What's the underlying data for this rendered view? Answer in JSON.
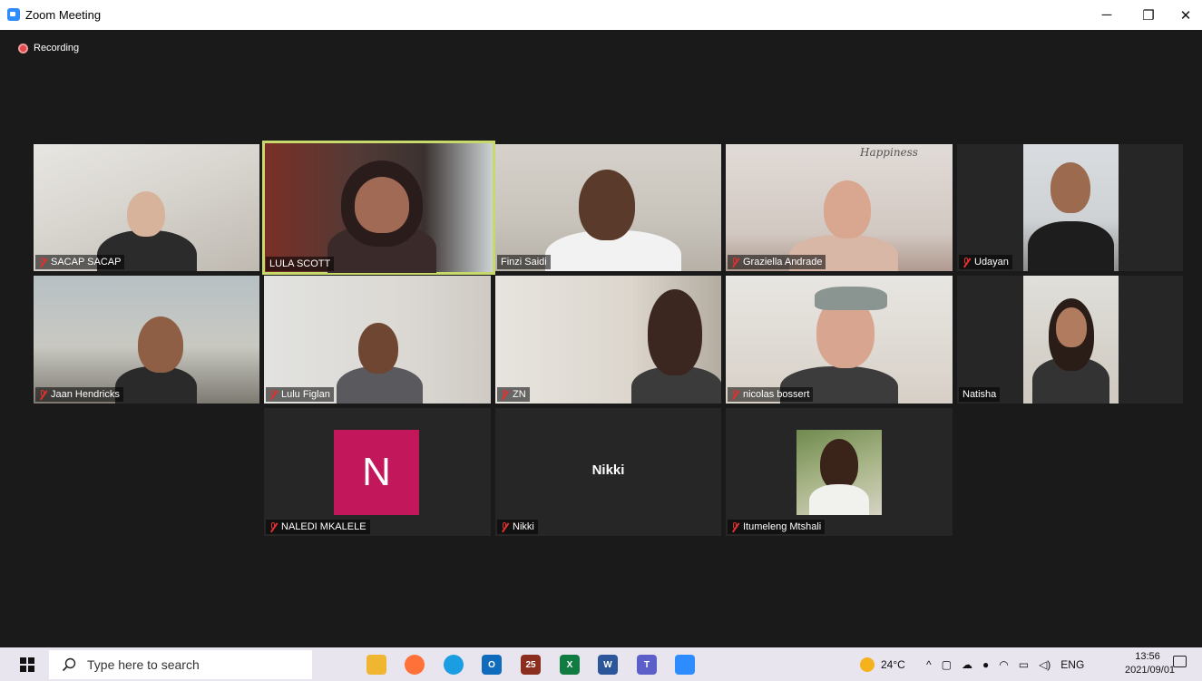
{
  "window": {
    "title": "Zoom Meeting",
    "controls": {
      "minimize": "─",
      "maximize": "❐",
      "close": "✕"
    }
  },
  "recording": {
    "label": "Recording"
  },
  "participants": [
    {
      "name": "SACAP SACAP",
      "muted": true
    },
    {
      "name": "LULA SCOTT",
      "muted": false,
      "active_speaker": true
    },
    {
      "name": "Finzi Saidi",
      "muted": false
    },
    {
      "name": "Graziella Andrade",
      "muted": true
    },
    {
      "name": "Udayan",
      "muted": true
    },
    {
      "name": "Jaan Hendricks",
      "muted": true
    },
    {
      "name": "Lulu Figlan",
      "muted": true
    },
    {
      "name": "ZN",
      "muted": true
    },
    {
      "name": "nicolas bossert",
      "muted": true
    },
    {
      "name": "Natisha",
      "muted": false
    },
    {
      "name": "NALEDI MKALELE",
      "muted": true,
      "avatar_letter": "N",
      "avatar_color": "#c2185b"
    },
    {
      "name": "Nikki",
      "muted": true,
      "video_off_name": "Nikki"
    },
    {
      "name": "Itumeleng Mtshali",
      "muted": true
    }
  ],
  "decor": {
    "happiness_sign": "Happiness"
  },
  "taskbar": {
    "search_placeholder": "Type here to search",
    "apps": [
      "file-explorer",
      "firefox",
      "edge",
      "outlook",
      "calendar-25",
      "excel",
      "word",
      "teams",
      "zoom"
    ],
    "calendar_label": "25",
    "weather": "24°C",
    "language": "ENG",
    "time": "13:56",
    "date": "2021/09/01"
  },
  "colors": {
    "active_speaker_border": "#c7d96b",
    "muted_icon": "#e0302f",
    "background": "#1a1a1a"
  }
}
